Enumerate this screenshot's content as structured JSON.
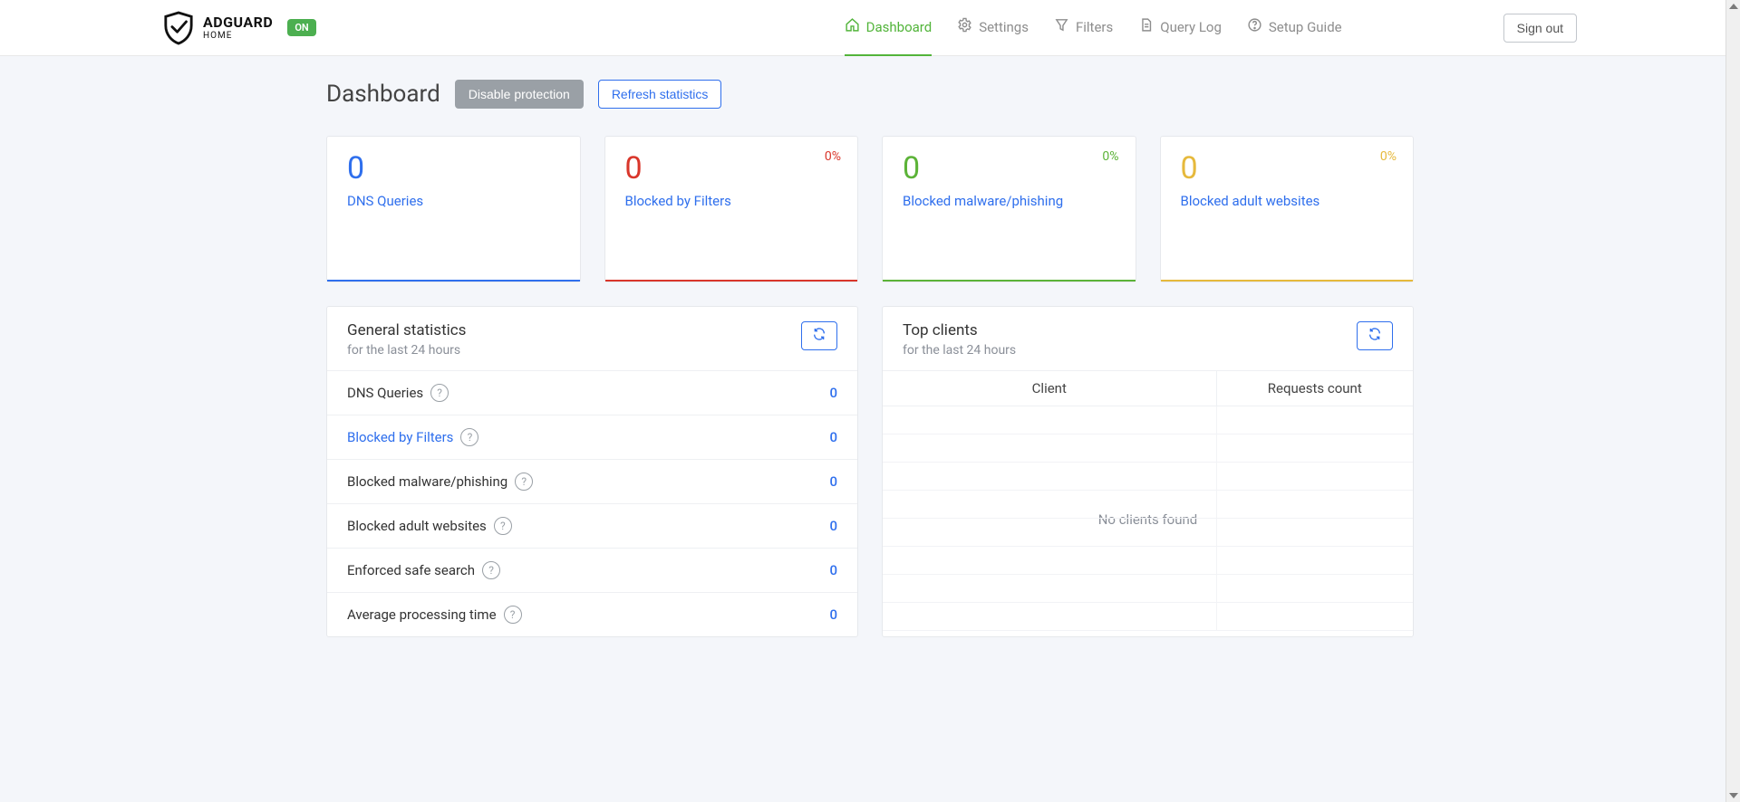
{
  "header": {
    "logo_top": "ADGUARD",
    "logo_bottom": "HOME",
    "status_badge": "ON",
    "nav": {
      "dashboard": "Dashboard",
      "settings": "Settings",
      "filters": "Filters",
      "query_log": "Query Log",
      "setup_guide": "Setup Guide"
    },
    "signout": "Sign out"
  },
  "page": {
    "title": "Dashboard",
    "disable_protection": "Disable protection",
    "refresh_statistics": "Refresh statistics"
  },
  "cards": {
    "dns_queries": {
      "value": "0",
      "label": "DNS Queries"
    },
    "blocked_filters": {
      "value": "0",
      "label": "Blocked by Filters",
      "pct": "0%"
    },
    "blocked_malware": {
      "value": "0",
      "label": "Blocked malware/phishing",
      "pct": "0%"
    },
    "blocked_adult": {
      "value": "0",
      "label": "Blocked adult websites",
      "pct": "0%"
    }
  },
  "general_stats": {
    "title": "General statistics",
    "subtitle": "for the last 24 hours",
    "items": [
      {
        "label": "DNS Queries",
        "value": "0",
        "link": false
      },
      {
        "label": "Blocked by Filters",
        "value": "0",
        "link": true
      },
      {
        "label": "Blocked malware/phishing",
        "value": "0",
        "link": false
      },
      {
        "label": "Blocked adult websites",
        "value": "0",
        "link": false
      },
      {
        "label": "Enforced safe search",
        "value": "0",
        "link": false
      },
      {
        "label": "Average processing time",
        "value": "0",
        "link": false
      }
    ]
  },
  "top_clients": {
    "title": "Top clients",
    "subtitle": "for the last 24 hours",
    "col_client": "Client",
    "col_requests": "Requests count",
    "empty": "No clients found"
  }
}
